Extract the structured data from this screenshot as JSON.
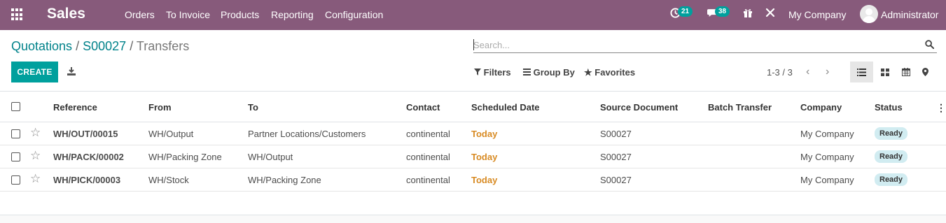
{
  "navbar": {
    "brand": "Sales",
    "menu": [
      "Orders",
      "To Invoice",
      "Products",
      "Reporting",
      "Configuration"
    ],
    "activity_count": "21",
    "messages_count": "38",
    "company": "My Company",
    "user": "Administrator",
    "bg_color": "#875a7b"
  },
  "breadcrumb": {
    "items": [
      "Quotations",
      "S00027"
    ],
    "separator": "/",
    "current": "Transfers"
  },
  "search": {
    "placeholder": "Search...",
    "value": ""
  },
  "toolbar": {
    "create_label": "CREATE",
    "filters_label": "Filters",
    "groupby_label": "Group By",
    "favorites_label": "Favorites",
    "pager": "1-3 / 3",
    "accent_color": "#00a09d"
  },
  "table": {
    "columns": [
      "Reference",
      "From",
      "To",
      "Contact",
      "Scheduled Date",
      "Source Document",
      "Batch Transfer",
      "Company",
      "Status"
    ],
    "rows": [
      {
        "reference": "WH/OUT/00015",
        "from": "WH/Output",
        "to": "Partner Locations/Customers",
        "contact": "continental",
        "scheduled": "Today",
        "source": "S00027",
        "batch": "",
        "company": "My Company",
        "status": "Ready"
      },
      {
        "reference": "WH/PACK/00002",
        "from": "WH/Packing Zone",
        "to": "WH/Output",
        "contact": "continental",
        "scheduled": "Today",
        "source": "S00027",
        "batch": "",
        "company": "My Company",
        "status": "Ready"
      },
      {
        "reference": "WH/PICK/00003",
        "from": "WH/Stock",
        "to": "WH/Packing Zone",
        "contact": "continental",
        "scheduled": "Today",
        "source": "S00027",
        "batch": "",
        "company": "My Company",
        "status": "Ready"
      }
    ]
  }
}
